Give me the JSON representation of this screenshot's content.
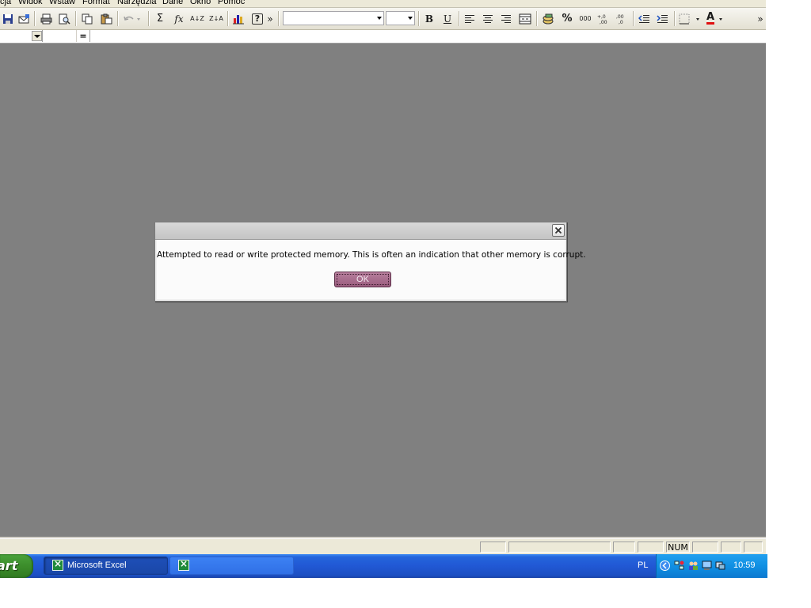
{
  "menu": {
    "items": [
      {
        "label": "cja",
        "accel": ""
      },
      {
        "label": "Widok",
        "accel": "W"
      },
      {
        "label": "Wstaw",
        "accel": "s"
      },
      {
        "label": "Format",
        "accel": "F"
      },
      {
        "label": "Narzędzia",
        "accel": "N"
      },
      {
        "label": "Dane",
        "accel": "D"
      },
      {
        "label": "Okno",
        "accel": "O"
      },
      {
        "label": "Pomoc",
        "accel": "P"
      }
    ]
  },
  "toolbar": {
    "autosum_glyph": "Σ",
    "function_glyph": "fx",
    "sort_asc_glyph": "A↓Z",
    "sort_desc_glyph": "Z↓A",
    "help_glyph": "?",
    "more_glyph": "»",
    "bold_glyph": "B",
    "underline_glyph": "U",
    "percent_glyph": "%",
    "thousands_glyph": "000",
    "font_color_glyph": "A",
    "font_name_value": "",
    "font_size_value": "",
    "colors": {
      "font_color": "#e01010"
    }
  },
  "formula": {
    "name_box_value": "",
    "equals_label": "="
  },
  "status": {
    "num_indicator": "NUM"
  },
  "dialog": {
    "title": "",
    "message": "Attempted to read or write protected memory. This is often an indication that other memory is corrupt.",
    "ok_label": "OK",
    "colors": {
      "ok_button": "#a86a8c"
    }
  },
  "taskbar": {
    "start_label": "art",
    "tasks": [
      {
        "label": "Microsoft Excel",
        "icon": "excel-icon",
        "active": true
      },
      {
        "label": "",
        "icon": "excel-icon",
        "active": false
      }
    ],
    "language": "PL",
    "clock": "10:59"
  }
}
